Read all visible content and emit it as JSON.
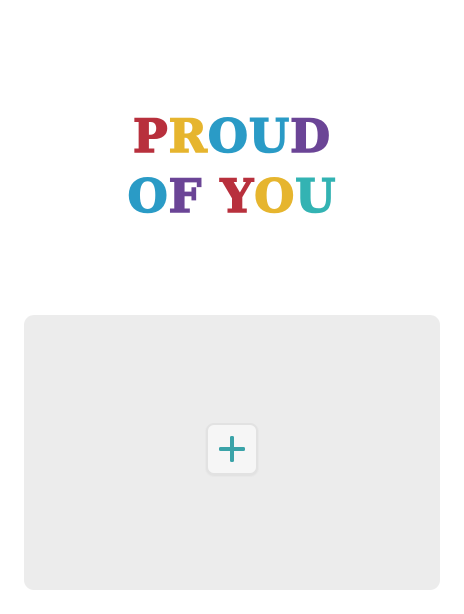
{
  "card": {
    "title_lines": [
      [
        {
          "char": "P",
          "color": "#b8303d"
        },
        {
          "char": "R",
          "color": "#e6b52e"
        },
        {
          "char": "O",
          "color": "#2a9bc6"
        },
        {
          "char": "U",
          "color": "#2a9bc6"
        },
        {
          "char": "D",
          "color": "#6b4596"
        }
      ],
      [
        {
          "char": "O",
          "color": "#2a9bc6"
        },
        {
          "char": "F",
          "color": "#6b4596"
        },
        {
          "char": " ",
          "color": ""
        },
        {
          "char": "Y",
          "color": "#b8303d"
        },
        {
          "char": "O",
          "color": "#e6b52e"
        },
        {
          "char": "U",
          "color": "#33b3b3"
        }
      ]
    ]
  },
  "upload": {
    "add_icon": "plus-icon",
    "accent_color": "#3aa3a8",
    "panel_color": "#ececec"
  }
}
